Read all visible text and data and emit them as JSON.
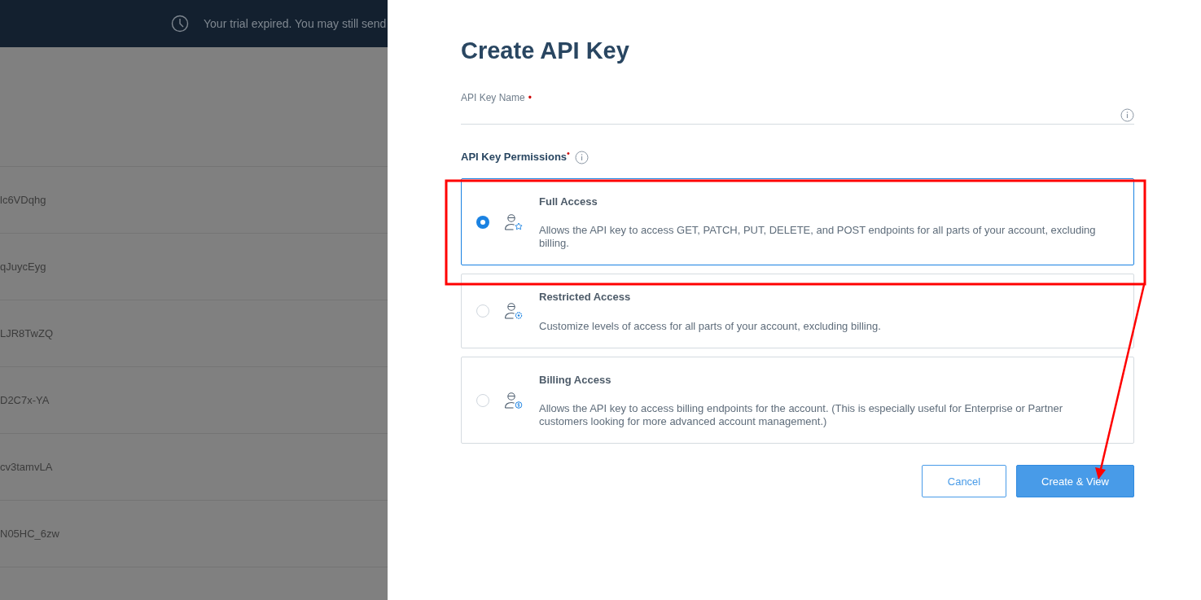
{
  "banner": {
    "text": "Your trial expired. You may still send"
  },
  "background_rows": [
    {
      "text": "lc6VDqhg"
    },
    {
      "text": "qJuycEyg"
    },
    {
      "text": "LJR8TwZQ"
    },
    {
      "text": "D2C7x-YA"
    },
    {
      "text": "cv3tamvLA"
    },
    {
      "text": "N05HC_6zw"
    }
  ],
  "dialog": {
    "title": "Create API Key",
    "name_field": {
      "label": "API Key Name",
      "required_mark": "•"
    },
    "permissions_label": "API Key Permissions",
    "permissions_required_mark": "•",
    "options": [
      {
        "kind": "star",
        "title": "Full Access",
        "description": "Allows the API key to access GET, PATCH, PUT, DELETE, and POST endpoints for all parts of your account, excluding billing.",
        "selected": true
      },
      {
        "kind": "gear",
        "title": "Restricted Access",
        "description": "Customize levels of access for all parts of your account, excluding billing.",
        "selected": false
      },
      {
        "kind": "dollar",
        "title": "Billing Access",
        "description": "Allows the API key to access billing endpoints for the account. (This is especially useful for Enterprise or Partner customers looking for more advanced account management.)",
        "selected": false
      }
    ],
    "buttons": [
      {
        "kind": "secondary",
        "label": "Cancel"
      },
      {
        "kind": "primary",
        "label": "Create & View"
      }
    ]
  }
}
